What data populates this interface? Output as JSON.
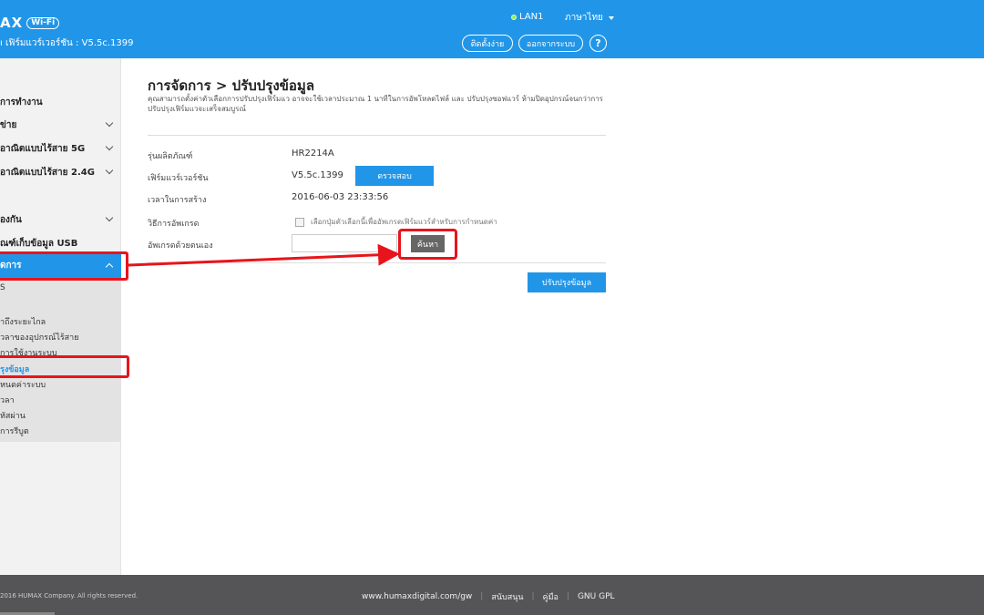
{
  "header": {
    "logo_text": "AX",
    "logo_badge": "Wi-Fi",
    "firmware_line": "ı เฟิร์มแวร์เวอร์ชัน : V5.5c.1399",
    "lan_status": "LAN1",
    "language": "ภาษาไทย",
    "setup_button": "ติดตั้งง่าย",
    "logout_button": "ออกจากระบบ",
    "help_label": "?"
  },
  "sidebar": {
    "items": [
      {
        "label": "การทำงาน",
        "chevron": false
      },
      {
        "label": "ข่าย",
        "chevron": true
      },
      {
        "label": "อาณิตแบบไร้สาย 5G",
        "chevron": true
      },
      {
        "label": "อาณิตแบบไร้สาย 2.4G",
        "chevron": true
      },
      {
        "label": "องกัน",
        "chevron": true
      },
      {
        "label": "ณฑ์เก็บข้อมูล USB",
        "chevron": false
      },
      {
        "label": "ดการ",
        "chevron": true,
        "active": true
      }
    ],
    "sub_items": [
      {
        "label": "S"
      },
      {
        "label": "าถึงระยะไกล"
      },
      {
        "label": "วลาของอุปกรณ์ไร้สาย"
      },
      {
        "label": "การใช้งานระบบ"
      },
      {
        "label": "รุงข้อมูล",
        "current": true
      },
      {
        "label": "หนดค่าระบบ"
      },
      {
        "label": "วลา"
      },
      {
        "label": "หัสผ่าน"
      },
      {
        "label": "การรีบูต"
      }
    ]
  },
  "main": {
    "title": "การจัดการ > ปรับปรุงข้อมูล",
    "description": "คุณสามารถตั้งค่าตัวเลือกการปรับปรุงเฟิร์มแว อาจจะใช้เวลาประมาณ 1 นาทีในการอัพโหลดไฟล์ และ ปรับปรุงซอฟแวร์ ห้ามปิดอุปกรณ์จนกว่าการปรับปรุงเฟิร์มแวจะเสร็จสมบูรณ์",
    "rows": {
      "model_label": "รุ่นผลิตภัณฑ์",
      "model_value": "HR2214A",
      "firmware_label": "เฟิร์มแวร์เวอร์ชัน",
      "firmware_value": "V5.5c.1399",
      "check_button": "ตรวจสอบ",
      "build_label": "เวลาในการสร้าง",
      "build_value": "2016-06-03 23:33:56",
      "upgrade_method_label": "วิธีการอัพเกรด",
      "auto_upgrade_checkbox_text": "เลือกปุ่มตัวเลือกนี้เพื่ออัพเกรดเฟิร์มแวร์สำหรับการกำหนดค่า",
      "manual_upgrade_label": "อัพเกรดด้วยตนเอง",
      "file_value": "",
      "browse_button": "ค้นหา"
    },
    "update_button": "ปรับปรุงข้อมูล"
  },
  "footer": {
    "copyright": "2016 HUMAX Company. All rights reserved.",
    "links": [
      "www.humaxdigital.com/gw",
      "สนับสนุน",
      "คู่มือ",
      "GNU GPL"
    ]
  },
  "colors": {
    "brand_blue": "#2196e8",
    "highlight_red": "#e8141b",
    "footer_gray": "#555558"
  }
}
